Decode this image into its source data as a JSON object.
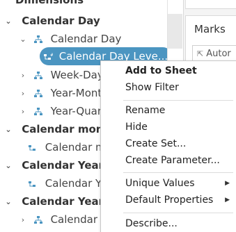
{
  "data_pane": {
    "heading": "Dimensions",
    "tree": {
      "calendar_day_group": "Calendar Day",
      "calendar_day_hierarchy": "Calendar Day",
      "selected_field": "Calendar Day Leve...",
      "week_day": "Week-Day",
      "year_month": "Year-Month",
      "year_quarter": "Year-Quart",
      "calendar_month_group": "Calendar month",
      "calendar_month_field": "Calendar m",
      "calendar_year_group": "Calendar Year",
      "calendar_year_field": "Calendar Ye",
      "calendar_year_m_group": "Calendar Year/M",
      "calendar_year_m_field": "Calendar Ye"
    }
  },
  "marks_card": {
    "title": "Marks",
    "mark_type": "Autor"
  },
  "context_menu": {
    "add_to_sheet": "Add to Sheet",
    "show_filter": "Show Filter",
    "rename": "Rename",
    "hide": "Hide",
    "create_set": "Create Set...",
    "create_parameter": "Create Parameter...",
    "unique_values": "Unique Values",
    "default_properties": "Default Properties",
    "describe": "Describe..."
  },
  "icons": {
    "expand": "chevron-down-icon",
    "collapse": "chevron-right-icon",
    "hierarchy": "hierarchy-icon",
    "submenu": "triangle-right-icon"
  },
  "colors": {
    "selection": "#4b95c1",
    "hierarchy_icon": "#4b95c1"
  }
}
